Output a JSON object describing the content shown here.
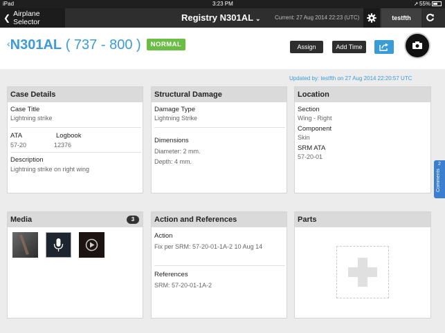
{
  "status_bar": {
    "device": "iPad",
    "time": "3:23 PM",
    "battery": "55%"
  },
  "nav": {
    "back_label": "Airplane Selector",
    "title": "Registry N301AL",
    "current": "Current: 27 Aug 2014 22:23 (UTC)",
    "user": "testfth"
  },
  "header": {
    "registration": "N301AL",
    "model": "( 737 - 800 )",
    "status_badge": "NORMAL",
    "assign_label": "Assign",
    "add_time_label": "Add Time"
  },
  "updated": {
    "label": "Updated by:",
    "user": "testfth",
    "when": "on 27 Aug 2014 22:20:57 UTC"
  },
  "case_details": {
    "title": "Case Details",
    "case_title_label": "Case Title",
    "case_title_value": "Lightning strike",
    "ata_label": "ATA",
    "ata_value": "57-20",
    "logbook_label": "Logbook",
    "logbook_value": "12376",
    "description_label": "Description",
    "description_value": "Lightning strike on right wing"
  },
  "structural_damage": {
    "title": "Structural Damage",
    "damage_type_label": "Damage Type",
    "damage_type_value": "Lightning Strike",
    "dimensions_label": "Dimensions",
    "diameter": "Diameter: 2 mm.",
    "depth": "Depth: 4 mm."
  },
  "location": {
    "title": "Location",
    "section_label": "Section",
    "section_value": "Wing - Right",
    "component_label": "Component",
    "component_value": "Skin",
    "srm_ata_label": "SRM ATA",
    "srm_ata_value": "57-20-01"
  },
  "media": {
    "title": "Media",
    "count": "3"
  },
  "action_refs": {
    "title": "Action and References",
    "action_label": "Action",
    "action_value": "Fix per SRM: 57-20-01-1A-2 10 Aug 14",
    "references_label": "References",
    "references_value": "SRM: 57-20-01-1A-2"
  },
  "parts": {
    "title": "Parts"
  },
  "comments": {
    "count": "2",
    "label": "Comments"
  },
  "colors": {
    "accent": "#3a9bd6",
    "normal_badge": "#6bbd45",
    "nav_bg": "#2e2e2e",
    "comments_tab": "#3a7fd0"
  }
}
